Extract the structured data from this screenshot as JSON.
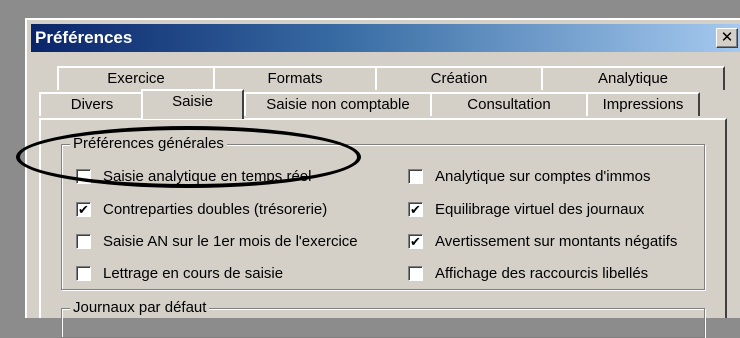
{
  "window": {
    "title": "Préférences",
    "close_glyph": "✕"
  },
  "tabs": {
    "row1": [
      "Exercice",
      "Formats",
      "Création",
      "Analytique"
    ],
    "row2": [
      "Divers",
      "Saisie",
      "Saisie non comptable",
      "Consultation",
      "Impressions"
    ],
    "active": "Saisie"
  },
  "groups": {
    "general_title": "Préférences générales",
    "journaux_title": "Journaux par défaut"
  },
  "checkboxes": [
    {
      "label": "Saisie analytique en temps réel",
      "checked": false
    },
    {
      "label": "Analytique sur comptes d'immos",
      "checked": false
    },
    {
      "label": "Contreparties doubles (trésorerie)",
      "checked": true
    },
    {
      "label": "Equilibrage virtuel des journaux",
      "checked": true
    },
    {
      "label": "Saisie AN sur le 1er mois de l'exercice",
      "checked": false
    },
    {
      "label": "Avertissement sur montants négatifs",
      "checked": true
    },
    {
      "label": "Lettrage en cours de saisie",
      "checked": false
    },
    {
      "label": "Affichage des raccourcis libellés",
      "checked": false
    }
  ],
  "annotation": {
    "shape": "ellipse",
    "color": "#000000"
  }
}
